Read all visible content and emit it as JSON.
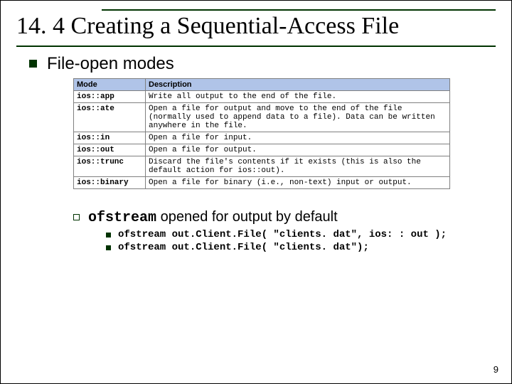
{
  "title": "14. 4      Creating a Sequential-Access File",
  "section_heading": "File-open modes",
  "table": {
    "headers": [
      "Mode",
      "Description"
    ],
    "rows": [
      {
        "mode": "ios::app",
        "desc": "Write all output to the end of the file."
      },
      {
        "mode": "ios::ate",
        "desc": "Open a file for output and move to the end of the file (normally used to append data to a file). Data can be written anywhere in the file."
      },
      {
        "mode": "ios::in",
        "desc": "Open a file for input."
      },
      {
        "mode": "ios::out",
        "desc": "Open a file for output."
      },
      {
        "mode": "ios::trunc",
        "desc": "Discard the file's contents if it exists (this is also the default action for ios::out)."
      },
      {
        "mode": "ios::binary",
        "desc": "Open a file for binary (i.e., non-text) input or output."
      }
    ]
  },
  "sub_point": {
    "code": "ofstream",
    "rest": " opened for output by default"
  },
  "code_lines": [
    "ofstream out.Client.File( \"clients. dat\", ios: : out );",
    "ofstream out.Client.File( \"clients. dat\");"
  ],
  "page_number": "9"
}
